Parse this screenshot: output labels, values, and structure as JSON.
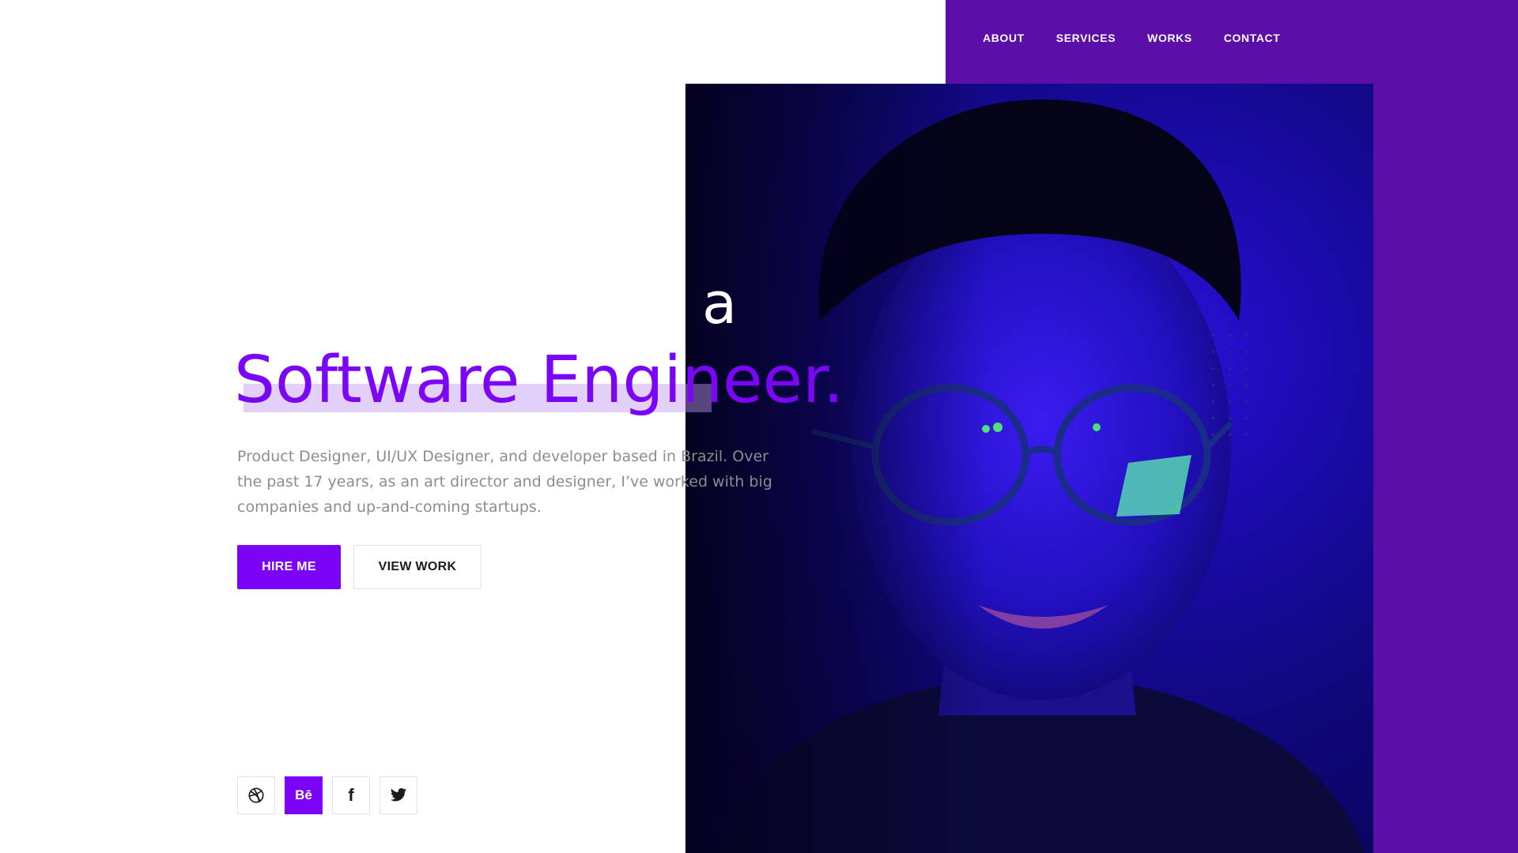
{
  "nav": {
    "items": [
      {
        "label": "ABOUT"
      },
      {
        "label": "SERVICES"
      },
      {
        "label": "WORKS"
      },
      {
        "label": "CONTACT"
      }
    ]
  },
  "hero": {
    "prefix": "a",
    "title": "Software Engineer.",
    "description": "Product Designer, UI/UX Designer, and developer based in Brazil. Over the past 17 years, as an art director and designer, I’ve worked with big companies and up-and-coming startups.",
    "primary_button": "HIRE ME",
    "secondary_button": "VIEW WORK"
  },
  "socials": [
    {
      "icon": "dribbble-icon"
    },
    {
      "icon": "behance-icon",
      "glyph": "Bē",
      "active": true
    },
    {
      "icon": "facebook-icon",
      "glyph": "f"
    },
    {
      "icon": "twitter-icon"
    }
  ],
  "colors": {
    "accent": "#7b04f6",
    "panel": "#5b0ea8",
    "highlight": "#d8c2f7",
    "text_muted": "#8d8d8d"
  }
}
